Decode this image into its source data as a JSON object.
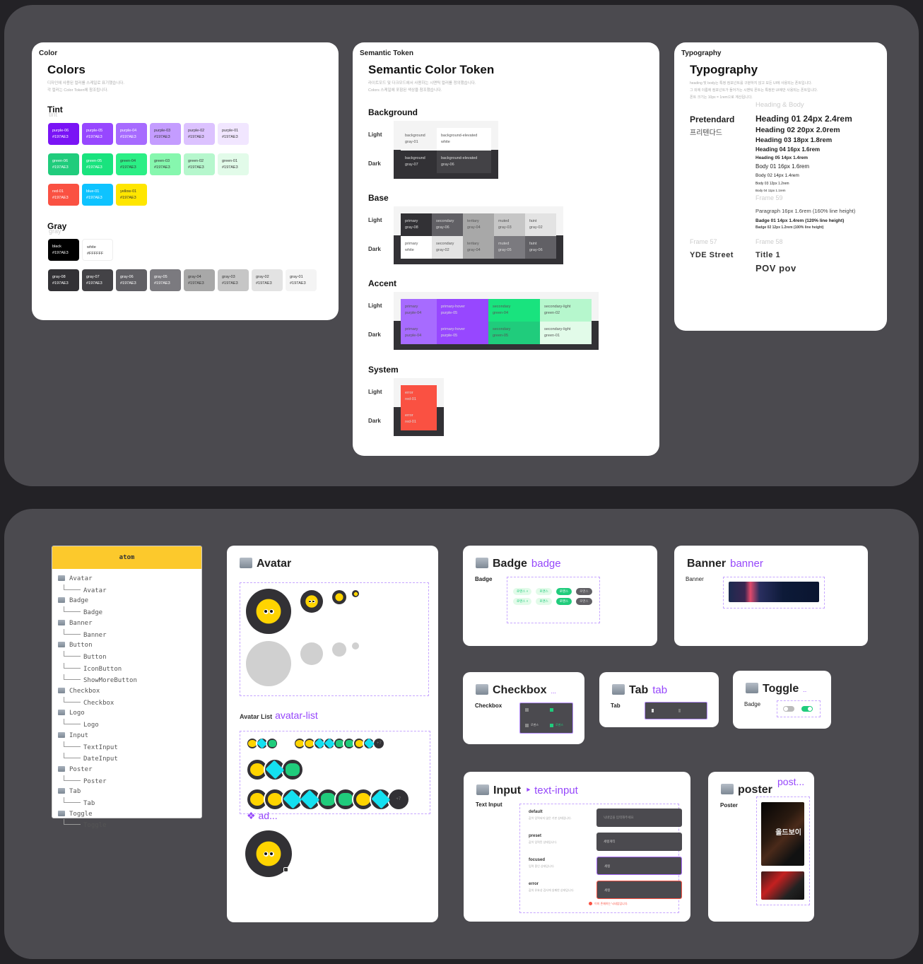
{
  "color_card": {
    "frame_label": "Color",
    "title": "Colors",
    "desc_1": "디자인에 사용된 컬러를 스케일로 표기했습니다.",
    "desc_2": "각 컬러는 Color Token에 참조됩니다.",
    "tint": {
      "title": "Tint",
      "ghost": "tint"
    },
    "purple": [
      {
        "name": "purple-06",
        "hex": "#197AE3",
        "color": "#7a14f5"
      },
      {
        "name": "purple-05",
        "hex": "#197AE3",
        "color": "#9747ff"
      },
      {
        "name": "purple-04",
        "hex": "#197AE3",
        "color": "#a76bff"
      },
      {
        "name": "purple-03",
        "hex": "#197AE3",
        "color": "#c49cff"
      },
      {
        "name": "purple-02",
        "hex": "#197AE3",
        "color": "#dcc2ff"
      },
      {
        "name": "purple-01",
        "hex": "#197AE3",
        "color": "#f1e6ff"
      }
    ],
    "green": [
      {
        "name": "green-06",
        "hex": "#197AE3",
        "color": "#20cc7c"
      },
      {
        "name": "green-05",
        "hex": "#197AE3",
        "color": "#19e37e"
      },
      {
        "name": "green-04",
        "hex": "#197AE3",
        "color": "#2bef85"
      },
      {
        "name": "green-03",
        "hex": "#197AE3",
        "color": "#86f7ae"
      },
      {
        "name": "green-02",
        "hex": "#197AE3",
        "color": "#b6f7cd"
      },
      {
        "name": "green-01",
        "hex": "#197AE3",
        "color": "#e2fbe9"
      }
    ],
    "misc": [
      {
        "name": "red-01",
        "hex": "#197AE3",
        "color": "#fa5142"
      },
      {
        "name": "blue-01",
        "hex": "#197AE3",
        "color": "#0ec3ff"
      },
      {
        "name": "yellow-01",
        "hex": "#197AE3",
        "color": "#ffe600"
      }
    ],
    "gray": {
      "title": "Gray",
      "ghost": "gray"
    },
    "bw": [
      {
        "name": "black",
        "hex": "#197AE3",
        "color": "#000000"
      },
      {
        "name": "white",
        "hex": "#FFFFFF",
        "color": "#ffffff"
      }
    ],
    "grays": [
      {
        "name": "gray-08",
        "hex": "#197AE3",
        "color": "#323135"
      },
      {
        "name": "gray-07",
        "hex": "#197AE3",
        "color": "#434246"
      },
      {
        "name": "gray-06",
        "hex": "#197AE3",
        "color": "#616065"
      },
      {
        "name": "gray-05",
        "hex": "#197AE3",
        "color": "#7b7a7f"
      },
      {
        "name": "gray-04",
        "hex": "#197AE3",
        "color": "#a8a8a8"
      },
      {
        "name": "gray-03",
        "hex": "#197AE3",
        "color": "#c6c6c6"
      },
      {
        "name": "gray-02",
        "hex": "#197AE3",
        "color": "#e3e3e3"
      },
      {
        "name": "gray-01",
        "hex": "#197AE3",
        "color": "#f4f4f4"
      }
    ]
  },
  "semantic_card": {
    "frame_label": "Semantic Token",
    "title": "Semantic Color Token",
    "desc_1": "라이트모드 및 다크모드에서 사용하는 시맨틱 컬러를 정의했습니다.",
    "desc_2": "Colors 스케일에 포함된 색상을 참조했습니다.",
    "light_label": "Light",
    "dark_label": "Dark",
    "background": {
      "title": "Background",
      "light": [
        {
          "t": "background",
          "v": "gray-01",
          "c": "#f4f4f4"
        },
        {
          "t": "background-elevated",
          "v": "white",
          "c": "#ffffff"
        }
      ],
      "dark": [
        {
          "t": "background",
          "v": "gray-07",
          "c": "#323135"
        },
        {
          "t": "background-elevated",
          "v": "gray-06",
          "c": "#434246"
        }
      ]
    },
    "base": {
      "title": "Base",
      "light": [
        {
          "t": "primary",
          "v": "gray-08",
          "c": "#323135"
        },
        {
          "t": "secondary",
          "v": "gray-06",
          "c": "#616065"
        },
        {
          "t": "teritary",
          "v": "gray-04",
          "c": "#a8a8a8"
        },
        {
          "t": "muted",
          "v": "gray-03",
          "c": "#c6c6c6"
        },
        {
          "t": "faint",
          "v": "gray-02",
          "c": "#e3e3e3"
        }
      ],
      "dark": [
        {
          "t": "primary",
          "v": "white",
          "c": "#ffffff"
        },
        {
          "t": "secondary",
          "v": "gray-02",
          "c": "#e3e3e3"
        },
        {
          "t": "teritary",
          "v": "gray-04",
          "c": "#a8a8a8"
        },
        {
          "t": "muted",
          "v": "gray-05",
          "c": "#7b7a7f"
        },
        {
          "t": "faint",
          "v": "gray-06",
          "c": "#616065"
        }
      ]
    },
    "accent": {
      "title": "Accent",
      "light": [
        {
          "t": "primary",
          "v": "purple-04",
          "c": "#a76bff"
        },
        {
          "t": "primary-hover",
          "v": "purple-05",
          "c": "#9747ff"
        },
        {
          "t": "secondary",
          "v": "green-04",
          "c": "#19e37e"
        },
        {
          "t": "secondary-light",
          "v": "green-02",
          "c": "#b6f7cd"
        }
      ],
      "dark": [
        {
          "t": "primary",
          "v": "purple-04",
          "c": "#a76bff"
        },
        {
          "t": "primary-hover",
          "v": "purple-05",
          "c": "#9747ff"
        },
        {
          "t": "secondary",
          "v": "green-05",
          "c": "#20cc7c"
        },
        {
          "t": "secondary-light",
          "v": "green-01",
          "c": "#e2fbe9"
        }
      ]
    },
    "system": {
      "title": "System",
      "light": [
        {
          "t": "error",
          "v": "red-01",
          "c": "#fa5142"
        }
      ],
      "dark": [
        {
          "t": "error",
          "v": "red-01",
          "c": "#fa5142"
        }
      ]
    }
  },
  "typography_card": {
    "frame_label": "Typography",
    "title": "Typography",
    "desc_1": "heading 및 body는 특정 컴포넌트를 구분하지 않고 모든 UI에 사용되는 폰트입니다.",
    "desc_2": "그 외에 이름에 컴포넌트가 들어가는 시맨틱 폰트는 특정한 UI에만 사용되는 폰트입니다.",
    "desc_3": "폰트 크기는 10px = 1rem으로 계산됩니다.",
    "group_heading": "Heading & Body",
    "font_name": "Pretendard",
    "font_name_kr": "프리텐다드",
    "styles": [
      "Heading 01  24px 2.4rem",
      "Heading 02  20px 2.0rem",
      "Heading 03  18px 1.8rem",
      "Heading 04  16px 1.6rem",
      "Heading 05  14px 1.4rem",
      "Body 01  16px 1.6rem",
      "Body 02  14px  1.4rem",
      "Body 03  12px 1.2rem",
      "Body 04  11px 1.1rem"
    ],
    "frame59": "Frame 59",
    "paragraph": "Paragraph  16px 1.6rem (160% line height)",
    "badge01": "Badge 01 14px 1.4rem (120% line height)",
    "badge02": "Badge 02  12px 1.2rem (100% line height)",
    "frame57": "Frame 57",
    "frame58": "Frame 58",
    "display_font": "YDE Street",
    "title1": "Title 1",
    "pov": "POV pov"
  },
  "atom_tree": {
    "header": "atom",
    "items": [
      {
        "label": "Avatar",
        "children": [
          "Avatar"
        ]
      },
      {
        "label": "Badge",
        "children": [
          "Badge"
        ]
      },
      {
        "label": "Banner",
        "children": [
          "Banner"
        ]
      },
      {
        "label": "Button",
        "children": [
          "Button",
          "IconButton",
          "ShowMoreButton"
        ]
      },
      {
        "label": "Checkbox",
        "children": [
          "Checkbox"
        ]
      },
      {
        "label": "Logo",
        "children": [
          "Logo"
        ]
      },
      {
        "label": "Input",
        "children": [
          "TextInput",
          "DateInput"
        ]
      },
      {
        "label": "Poster",
        "children": [
          "Poster"
        ]
      },
      {
        "label": "Tab",
        "children": [
          "Tab"
        ]
      },
      {
        "label": "Toggle",
        "children": [
          "Toggle"
        ]
      }
    ]
  },
  "avatar_card": {
    "title": "Avatar",
    "list_label": "Avatar List",
    "list_tag": "avatar-list",
    "overflow": "+7",
    "add_tag": "ad..."
  },
  "badge_card": {
    "title": "Badge",
    "tag": "badge",
    "sub": "Badge",
    "row1": [
      "로맨스 ×",
      "로맨스",
      "로맨스",
      "로맨스"
    ],
    "row2": [
      "로맨스 ×",
      "로맨스",
      "로맨스",
      "로맨스"
    ]
  },
  "banner_card": {
    "title": "Banner",
    "tag": "banner",
    "sub": "Banner"
  },
  "checkbox_card": {
    "title": "Checkbox",
    "tag": "...",
    "sub": "Checkbox",
    "label": "로맨스"
  },
  "tab_card": {
    "title": "Tab",
    "tag": "tab",
    "sub": "Tab"
  },
  "toggle_card": {
    "title": "Toggle",
    "tag": "..",
    "sub": "Badge"
  },
  "input_card": {
    "title": "Input",
    "tag": "text-input",
    "sub": "Text Input",
    "states": [
      {
        "name": "default",
        "desc": "값이 입력되지 않은 기본 상태입니다.",
        "value": "닉네임을 입력해주세요"
      },
      {
        "name": "preset",
        "desc": "값이 입력된 상태입니다.",
        "value": "세렝게티"
      },
      {
        "name": "focused",
        "desc": "입력 중인 상태입니다.",
        "value": "세렝"
      },
      {
        "name": "error",
        "desc": "값의 유효성 검사에 실패한 상태입니다.",
        "value": "세렝"
      }
    ],
    "error_msg": "이미 존재하는 닉네임입니다."
  },
  "poster_card": {
    "title": "poster",
    "tag": "post...",
    "sub": "Poster",
    "poster_text": "올드보이"
  }
}
